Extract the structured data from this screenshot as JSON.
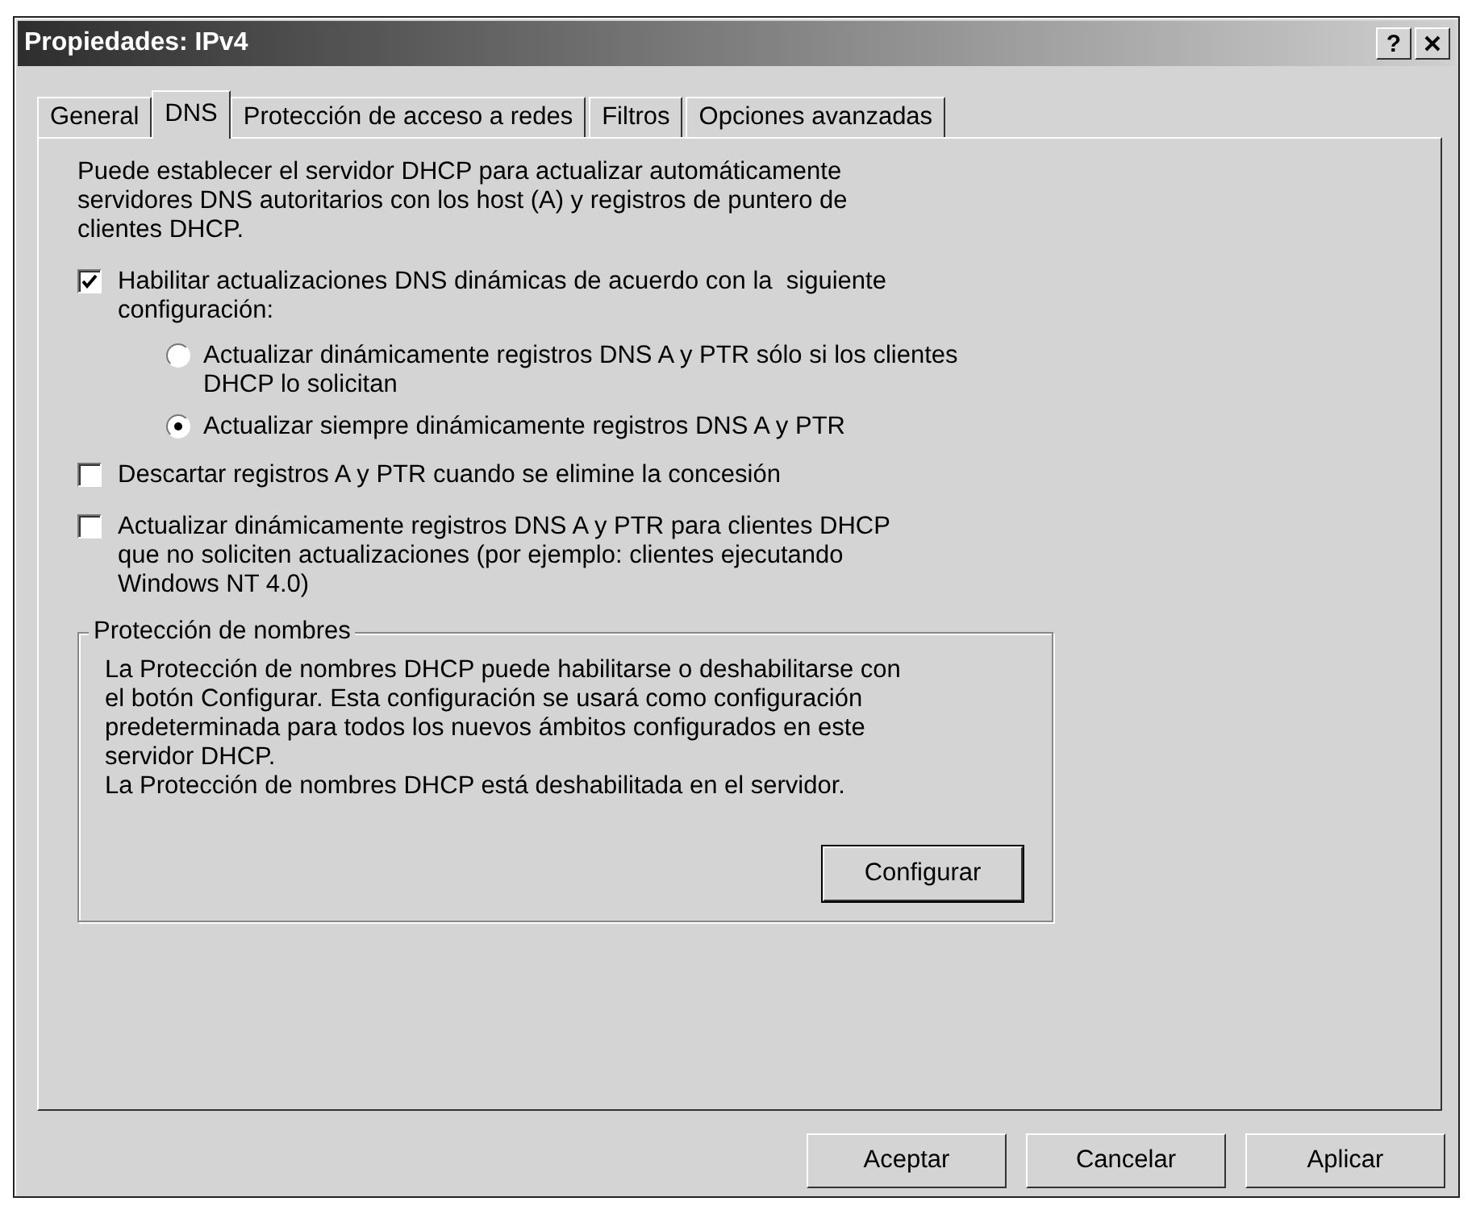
{
  "window": {
    "title": "Propiedades: IPv4",
    "help": "?"
  },
  "tabs": [
    {
      "label": "General",
      "selected": false
    },
    {
      "label": "DNS",
      "selected": true
    },
    {
      "label": "Protección de acceso a redes",
      "selected": false
    },
    {
      "label": "Filtros",
      "selected": false
    },
    {
      "label": "Opciones avanzadas",
      "selected": false
    }
  ],
  "description": "Puede establecer el servidor DHCP para actualizar automáticamente\nservidores DNS autoritarios con los host (A) y registros de puntero de\nclientes DHCP.",
  "options": [
    {
      "kind": "checkbox",
      "label": "Habilitar actualizaciones DNS dinámicas de acuerdo con la  siguiente\nconfiguración:",
      "checked": true,
      "children": [
        {
          "kind": "radio",
          "label": "Actualizar dinámicamente registros DNS A y PTR sólo si los clientes\nDHCP lo solicitan",
          "selected": false
        },
        {
          "kind": "radio",
          "label": "Actualizar siempre dinámicamente registros DNS A y PTR",
          "selected": true
        }
      ]
    },
    {
      "kind": "checkbox",
      "label": "Descartar registros A y PTR cuando se elimine la concesión",
      "checked": false
    },
    {
      "kind": "checkbox",
      "label": "Actualizar dinámicamente registros DNS A y PTR para clientes DHCP\nque no soliciten actualizaciones (por ejemplo: clientes ejecutando\nWindows NT 4.0)",
      "checked": false
    }
  ],
  "name_protection": {
    "title": "Protección de nombres",
    "text": "La Protección de nombres DHCP puede habilitarse o deshabilitarse con\nel botón Configurar. Esta configuración se usará como configuración\npredeterminada para todos los nuevos ámbitos configurados en este\nservidor DHCP.\nLa Protección de nombres DHCP está deshabilitada en el servidor.",
    "button": "Configurar"
  },
  "buttons": [
    "Aceptar",
    "Cancelar",
    "Aplicar"
  ]
}
